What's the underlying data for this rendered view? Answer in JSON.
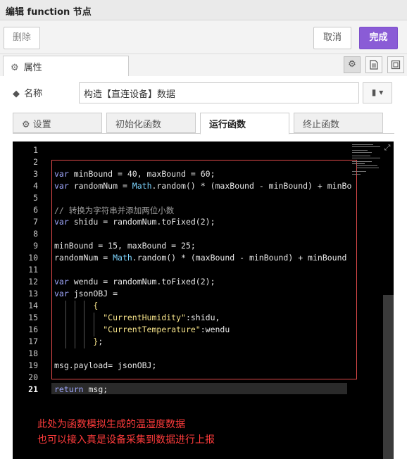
{
  "title": "编辑 function 节点",
  "actions": {
    "delete": "删除",
    "cancel": "取消",
    "done": "完成"
  },
  "tabs": {
    "properties": "属性"
  },
  "name_field": {
    "label": "名称",
    "value": "构造【直连设备】数据"
  },
  "subtabs": [
    "设置",
    "初始化函数",
    "运行函数",
    "终止函数"
  ],
  "editor": {
    "line_numbers": [
      "1",
      "2",
      "3",
      "4",
      "5",
      "6",
      "7",
      "8",
      "9",
      "10",
      "11",
      "12",
      "13",
      "14",
      "15",
      "16",
      "17",
      "18",
      "19",
      "20",
      "21"
    ],
    "current_line": "21"
  },
  "annotation": {
    "line1": "此处为函数模拟生成的温湿度数据",
    "line2": "也可以接入真是设备采集到数据进行上报"
  },
  "icons": {
    "gear": "gear-icon",
    "doc": "document-icon",
    "frame": "frame-icon",
    "tag": "tag-icon",
    "book": "book-icon"
  },
  "colors": {
    "done_button": "#8a5cd6",
    "annotation": "#ff3b3b",
    "highlight_box": "#e04a4a"
  }
}
